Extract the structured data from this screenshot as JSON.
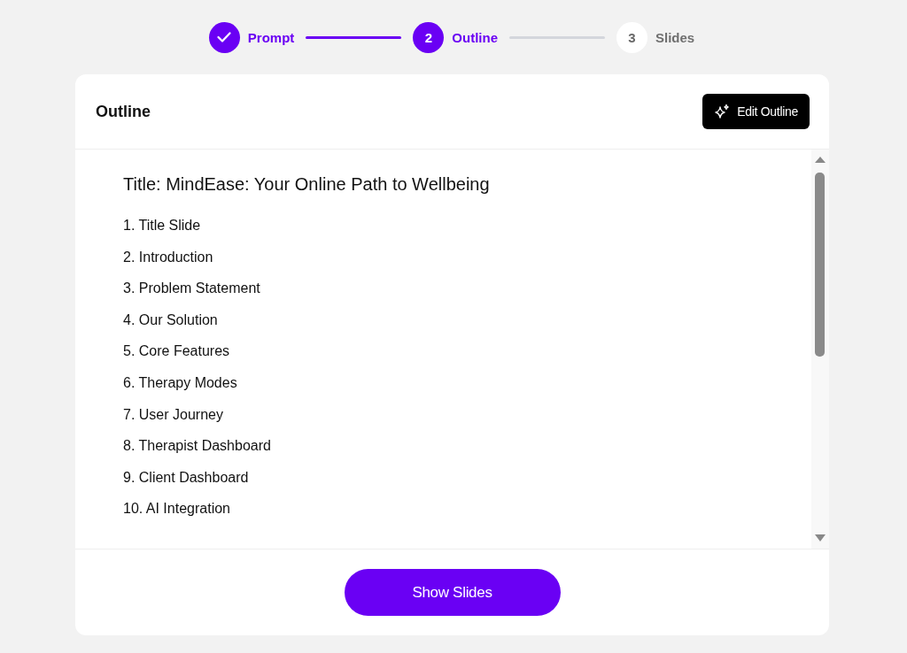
{
  "stepper": [
    {
      "label": "Prompt",
      "done": true,
      "selected": false
    },
    {
      "number": "2",
      "label": "Outline",
      "done": false,
      "selected": true
    },
    {
      "number": "3",
      "label": "Slides",
      "done": false,
      "selected": false
    }
  ],
  "outline": {
    "heading": "Outline",
    "edit_button": "Edit Outline",
    "title": "Title: MindEase: Your Online Path to Wellbeing",
    "items": [
      "1. Title Slide",
      "2. Introduction",
      "3. Problem Statement",
      "4. Our Solution",
      "5. Core Features",
      "6. Therapy Modes",
      "7. User Journey",
      "8. Therapist Dashboard",
      "9. Client Dashboard",
      "10. AI Integration"
    ],
    "primary_button": "Show Slides"
  }
}
